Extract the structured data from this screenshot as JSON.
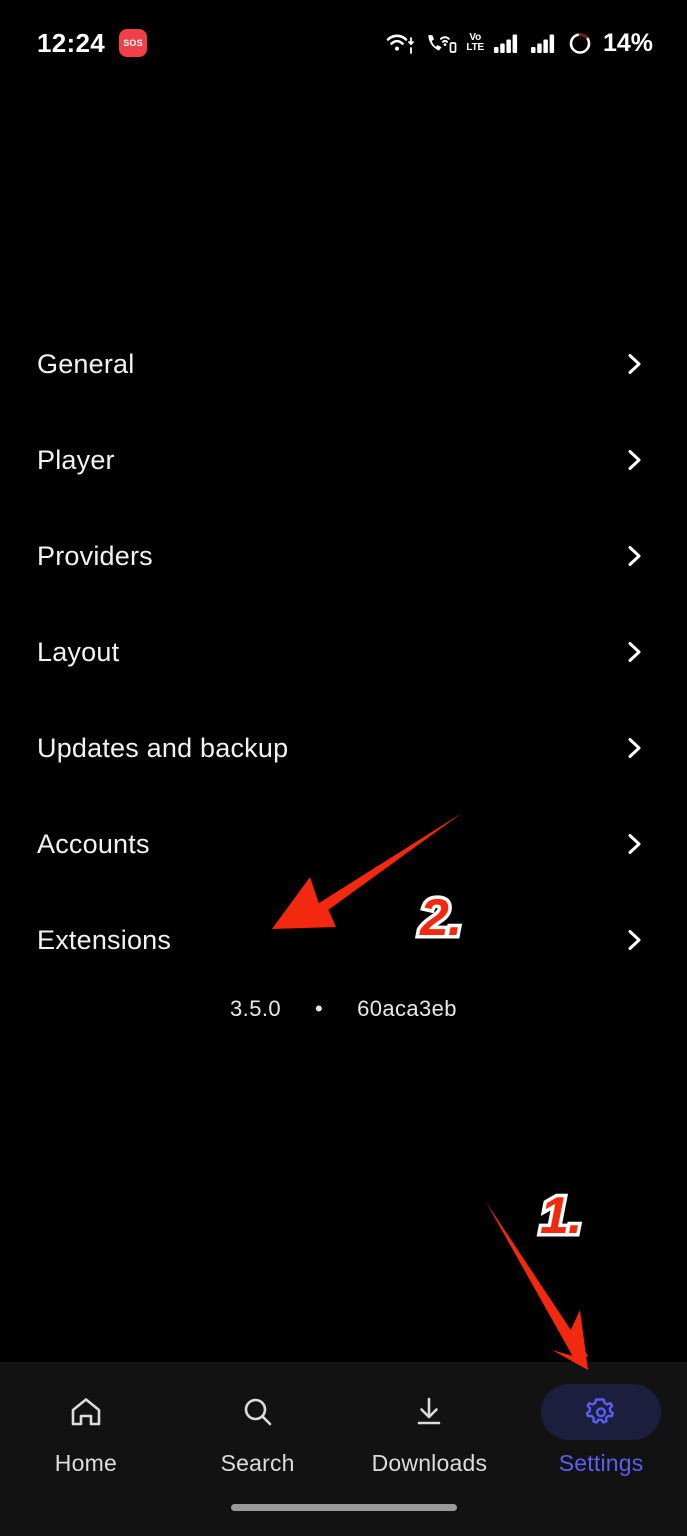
{
  "status_bar": {
    "time": "12:24",
    "sos_badge": "SOS",
    "volte_top": "Vo",
    "volte_bottom": "LTE",
    "battery_percent": "14%",
    "icons": [
      "wifi-icon",
      "call-over-wifi-icon",
      "volte-icon",
      "signal-bars-sim1-icon",
      "signal-bars-sim2-icon",
      "battery-ring-icon"
    ]
  },
  "settings_list": {
    "items": [
      {
        "label": "General"
      },
      {
        "label": "Player"
      },
      {
        "label": "Providers"
      },
      {
        "label": "Layout"
      },
      {
        "label": "Updates and backup"
      },
      {
        "label": "Accounts"
      },
      {
        "label": "Extensions"
      }
    ]
  },
  "version": {
    "number": "3.5.0",
    "separator": "•",
    "commit": "60aca3eb"
  },
  "bottom_nav": {
    "items": [
      {
        "label": "Home",
        "icon": "home-icon",
        "active": false
      },
      {
        "label": "Search",
        "icon": "search-icon",
        "active": false
      },
      {
        "label": "Downloads",
        "icon": "download-icon",
        "active": false
      },
      {
        "label": "Settings",
        "icon": "gear-icon",
        "active": true
      }
    ]
  },
  "annotations": {
    "step1": {
      "number": "1.",
      "points_to": "Settings"
    },
    "step2": {
      "number": "2.",
      "points_to": "Extensions"
    }
  },
  "colors": {
    "background": "#000000",
    "nav_background": "#121212",
    "accent_blue": "#5b5ef0",
    "active_pill": "#1b1f3d",
    "annotation_red": "#f3290f",
    "sos_red": "#f0404a",
    "text_primary": "#f2f2f2"
  }
}
